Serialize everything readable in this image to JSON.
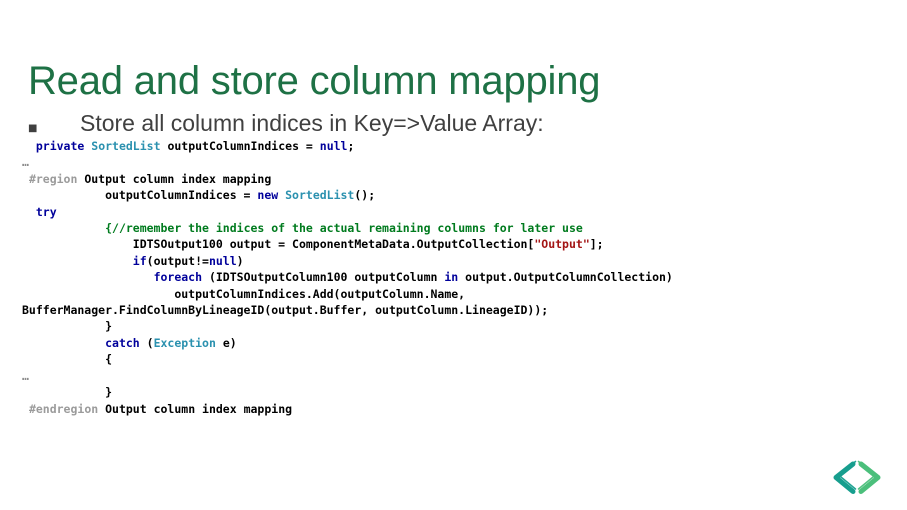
{
  "slide": {
    "title": "Read and store column mapping",
    "bullet": {
      "marker": "§",
      "text": "Store all column indices in Key=>Value Array:"
    },
    "colors": {
      "title_green": "#1E7145",
      "body_gray": "#404040",
      "keyword_blue": "#00009B",
      "type_teal": "#2B91AF",
      "comment_green": "#007B1E",
      "string_red": "#A31515",
      "preprocessor_gray": "#9B9B9B",
      "logo_dark_teal": "#179E8E",
      "logo_light_green": "#4BBF7B"
    },
    "code_lines": [
      {
        "id": "line-declaration",
        "tokens": [
          {
            "text": "  ",
            "style": "plain"
          },
          {
            "text": "private",
            "style": "kw"
          },
          {
            "text": " ",
            "style": "plain"
          },
          {
            "text": "SortedList",
            "style": "type"
          },
          {
            "text": " outputColumnIndices = ",
            "style": "plain"
          },
          {
            "text": "null",
            "style": "kw"
          },
          {
            "text": ";",
            "style": "plain"
          }
        ]
      },
      {
        "id": "line-ellipsis-1",
        "tokens": [
          {
            "text": "…",
            "style": "ellipsis"
          }
        ]
      },
      {
        "id": "line-region",
        "tokens": [
          {
            "text": " ",
            "style": "plain"
          },
          {
            "text": "#region",
            "style": "pre"
          },
          {
            "text": " Output column index mapping",
            "style": "plain"
          }
        ]
      },
      {
        "id": "line-new-sortedlist",
        "tokens": [
          {
            "text": "            outputColumnIndices = ",
            "style": "plain"
          },
          {
            "text": "new",
            "style": "kw"
          },
          {
            "text": " ",
            "style": "plain"
          },
          {
            "text": "SortedList",
            "style": "type"
          },
          {
            "text": "();",
            "style": "plain"
          }
        ]
      },
      {
        "id": "line-try",
        "tokens": [
          {
            "text": "  ",
            "style": "plain"
          },
          {
            "text": "try",
            "style": "kw"
          }
        ]
      },
      {
        "id": "line-comment",
        "tokens": [
          {
            "text": "            {",
            "style": "comment"
          },
          {
            "text": "//remember the indices of the actual remaining columns for later use",
            "style": "comment"
          }
        ]
      },
      {
        "id": "line-output-assign",
        "tokens": [
          {
            "text": "                IDTSOutput100 output = ComponentMetaData.OutputCollection[",
            "style": "plain"
          },
          {
            "text": "\"Output\"",
            "style": "string"
          },
          {
            "text": "];",
            "style": "plain"
          }
        ]
      },
      {
        "id": "line-if-null",
        "tokens": [
          {
            "text": "                ",
            "style": "plain"
          },
          {
            "text": "if",
            "style": "kw"
          },
          {
            "text": "(output!=",
            "style": "plain"
          },
          {
            "text": "null",
            "style": "kw"
          },
          {
            "text": ")",
            "style": "plain"
          }
        ]
      },
      {
        "id": "line-foreach",
        "tokens": [
          {
            "text": "                   ",
            "style": "plain"
          },
          {
            "text": "foreach",
            "style": "kw"
          },
          {
            "text": " (IDTSOutputColumn100 outputColumn ",
            "style": "plain"
          },
          {
            "text": "in",
            "style": "kw"
          },
          {
            "text": " output.OutputColumnCollection)",
            "style": "plain"
          }
        ]
      },
      {
        "id": "line-add",
        "tokens": [
          {
            "text": "                      outputColumnIndices.Add(outputColumn.Name,",
            "style": "plain"
          }
        ]
      },
      {
        "id": "line-buffermanager",
        "tokens": [
          {
            "text": "BufferManager.FindColumnByLineageID(output.Buffer, outputColumn.LineageID));",
            "style": "plain"
          }
        ]
      },
      {
        "id": "line-close-brace-1",
        "tokens": [
          {
            "text": "            }",
            "style": "plain"
          }
        ]
      },
      {
        "id": "line-catch",
        "tokens": [
          {
            "text": "            ",
            "style": "plain"
          },
          {
            "text": "catch",
            "style": "kw"
          },
          {
            "text": " (",
            "style": "plain"
          },
          {
            "text": "Exception",
            "style": "type"
          },
          {
            "text": " e)",
            "style": "plain"
          }
        ]
      },
      {
        "id": "line-open-brace",
        "tokens": [
          {
            "text": "            {",
            "style": "plain"
          }
        ]
      },
      {
        "id": "line-ellipsis-2",
        "tokens": [
          {
            "text": "…",
            "style": "ellipsis"
          }
        ]
      },
      {
        "id": "line-close-brace-2",
        "tokens": [
          {
            "text": "            }",
            "style": "plain"
          }
        ]
      },
      {
        "id": "line-endregion",
        "tokens": [
          {
            "text": " ",
            "style": "plain"
          },
          {
            "text": "#endregion",
            "style": "pre"
          },
          {
            "text": " Output column index mapping",
            "style": "plain"
          }
        ]
      }
    ],
    "logo": {
      "name": "code-brackets-logo"
    }
  }
}
